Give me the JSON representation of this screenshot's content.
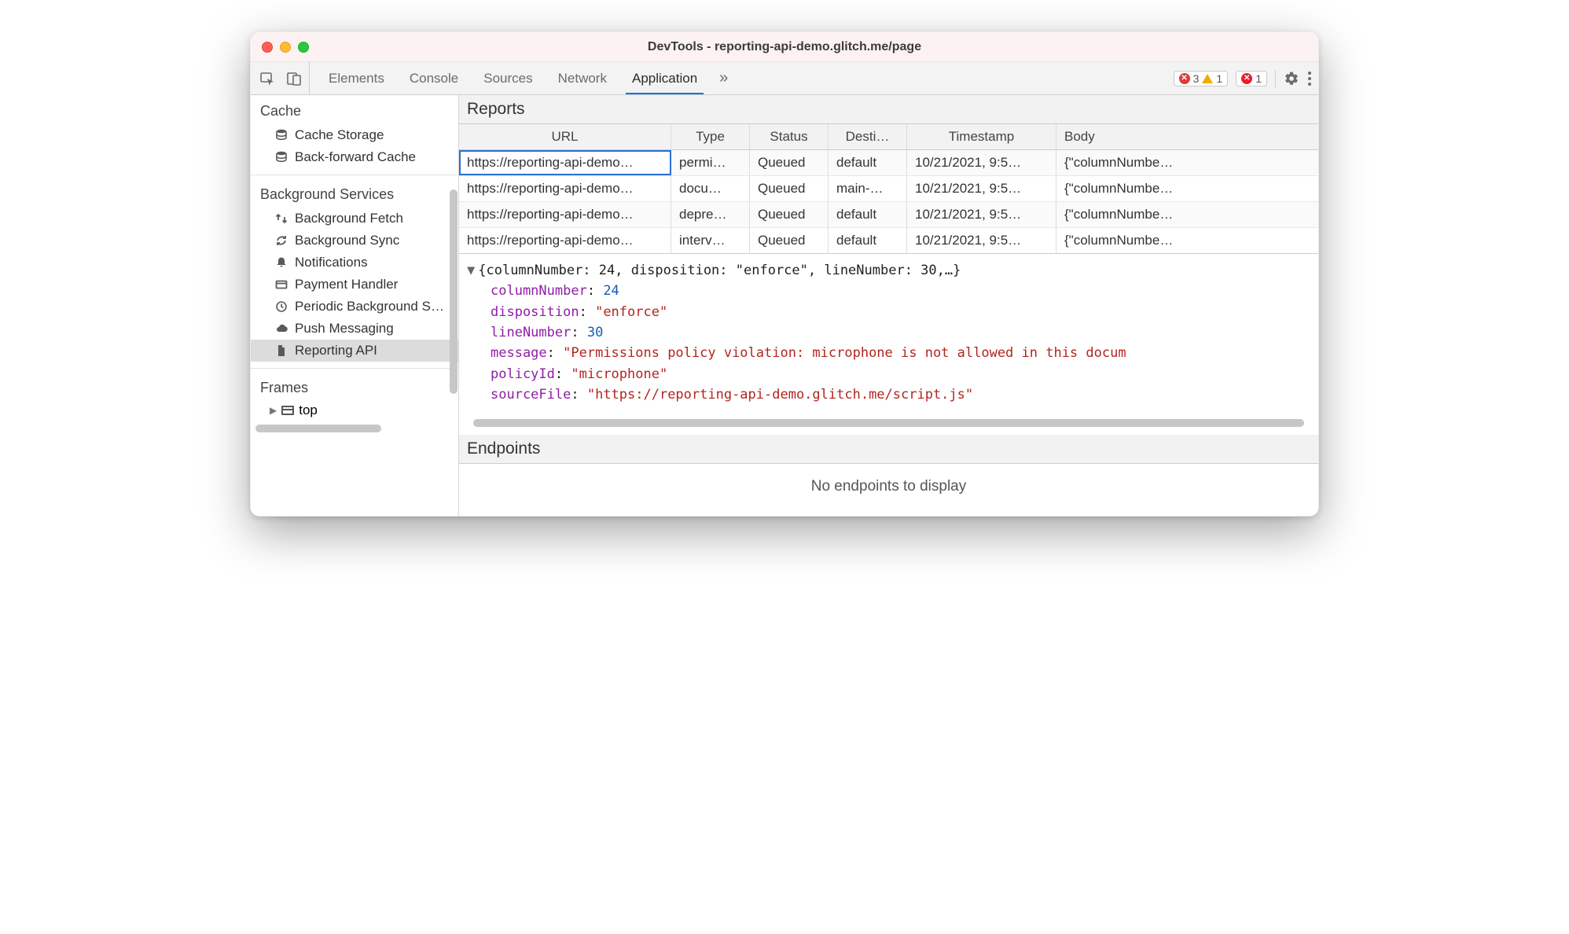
{
  "window": {
    "title": "DevTools - reporting-api-demo.glitch.me/page"
  },
  "toolbar": {
    "tabs": [
      "Elements",
      "Console",
      "Sources",
      "Network",
      "Application"
    ],
    "active_tab_index": 4,
    "overflow_glyph": "»",
    "status": {
      "errors": "3",
      "warnings": "1",
      "issues": "1"
    }
  },
  "sidebar": {
    "groups": [
      {
        "title": "Cache",
        "items": [
          {
            "icon": "database",
            "label": "Cache Storage"
          },
          {
            "icon": "database",
            "label": "Back-forward Cache"
          }
        ]
      },
      {
        "title": "Background Services",
        "items": [
          {
            "icon": "exchange",
            "label": "Background Fetch"
          },
          {
            "icon": "sync",
            "label": "Background Sync"
          },
          {
            "icon": "bell",
            "label": "Notifications"
          },
          {
            "icon": "card",
            "label": "Payment Handler"
          },
          {
            "icon": "clock",
            "label": "Periodic Background Sync"
          },
          {
            "icon": "cloud",
            "label": "Push Messaging"
          },
          {
            "icon": "doc",
            "label": "Reporting API",
            "selected": true
          }
        ]
      },
      {
        "title": "Frames",
        "frames": [
          {
            "label": "top"
          }
        ]
      }
    ]
  },
  "reports": {
    "title": "Reports",
    "columns": [
      "URL",
      "Type",
      "Status",
      "Desti…",
      "Timestamp",
      "Body"
    ],
    "rows": [
      {
        "url": "https://reporting-api-demo…",
        "type": "permi…",
        "status": "Queued",
        "dest": "default",
        "ts": "10/21/2021, 9:5…",
        "body": "{\"columnNumbe…",
        "selected": true
      },
      {
        "url": "https://reporting-api-demo…",
        "type": "docu…",
        "status": "Queued",
        "dest": "main-…",
        "ts": "10/21/2021, 9:5…",
        "body": "{\"columnNumbe…"
      },
      {
        "url": "https://reporting-api-demo…",
        "type": "depre…",
        "status": "Queued",
        "dest": "default",
        "ts": "10/21/2021, 9:5…",
        "body": "{\"columnNumbe…"
      },
      {
        "url": "https://reporting-api-demo…",
        "type": "interv…",
        "status": "Queued",
        "dest": "default",
        "ts": "10/21/2021, 9:5…",
        "body": "{\"columnNumbe…"
      }
    ],
    "detail": {
      "summary": "{columnNumber: 24, disposition: \"enforce\", lineNumber: 30,…}",
      "columnNumber": "24",
      "disposition": "\"enforce\"",
      "lineNumber": "30",
      "message": "\"Permissions policy violation: microphone is not allowed in this docum",
      "policyId": "\"microphone\"",
      "sourceFile": "\"https://reporting-api-demo.glitch.me/script.js\""
    }
  },
  "endpoints": {
    "title": "Endpoints",
    "empty_message": "No endpoints to display"
  }
}
